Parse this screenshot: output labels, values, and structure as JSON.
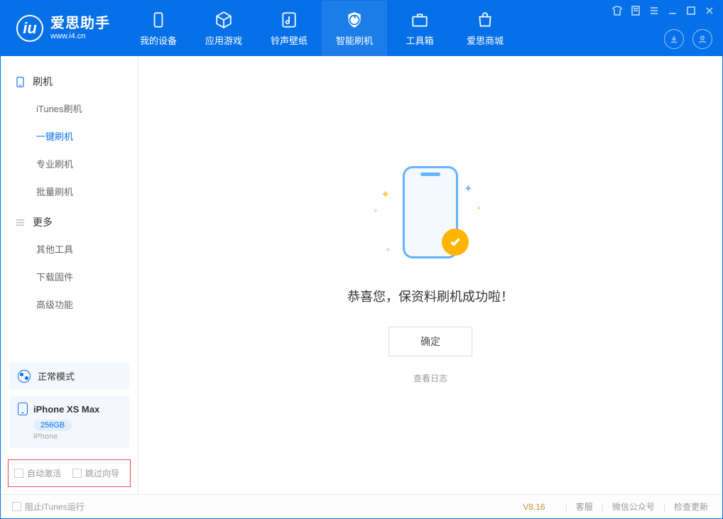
{
  "app": {
    "title": "爱思助手",
    "subtitle": "www.i4.cn"
  },
  "nav": {
    "device": "我的设备",
    "apps": "应用游戏",
    "ring": "铃声壁纸",
    "flash": "智能刷机",
    "toolbox": "工具箱",
    "store": "爱思商城"
  },
  "sidebar": {
    "group_flash": "刷机",
    "items_flash": {
      "itunes": "iTunes刷机",
      "onekey": "一键刷机",
      "pro": "专业刷机",
      "batch": "批量刷机"
    },
    "group_more": "更多",
    "items_more": {
      "other": "其他工具",
      "download": "下载固件",
      "advanced": "高级功能"
    },
    "mode": "正常模式",
    "device_name": "iPhone XS Max",
    "device_capacity": "256GB",
    "device_type": "iPhone",
    "auto_activate": "自动激活",
    "skip_guide": "跳过向导"
  },
  "main": {
    "success_msg": "恭喜您，保资料刷机成功啦！",
    "ok": "确定",
    "view_log": "查看日志"
  },
  "footer": {
    "block_itunes": "阻止iTunes运行",
    "version": "V8.16",
    "support": "客服",
    "wechat": "微信公众号",
    "update": "检查更新"
  }
}
